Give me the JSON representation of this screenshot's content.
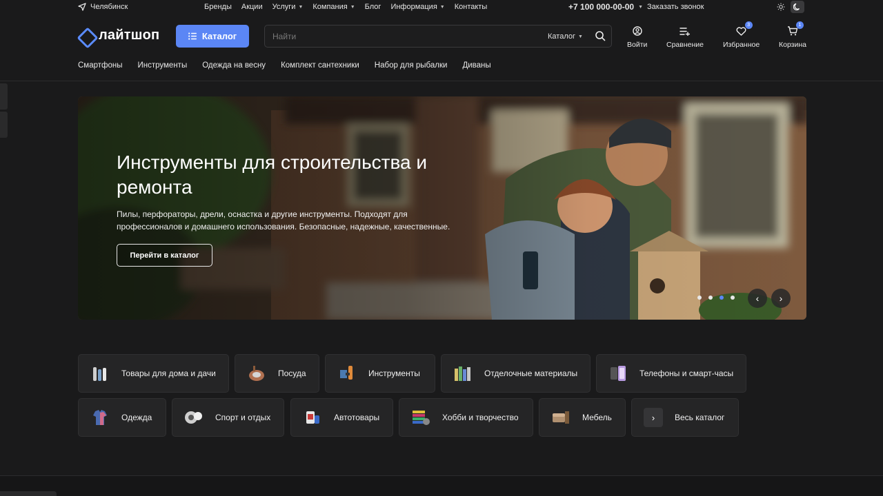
{
  "topbar": {
    "city": "Челябинск",
    "nav": [
      {
        "label": "Бренды",
        "caret": false
      },
      {
        "label": "Акции",
        "caret": false
      },
      {
        "label": "Услуги",
        "caret": true
      },
      {
        "label": "Компания",
        "caret": true
      },
      {
        "label": "Блог",
        "caret": false
      },
      {
        "label": "Информация",
        "caret": true
      },
      {
        "label": "Контакты",
        "caret": false
      }
    ],
    "phone": "+7 100 000-00-00",
    "callback": "Заказать звонок",
    "theme_light_icon": "sun-icon",
    "theme_dark_icon": "moon-icon"
  },
  "header": {
    "logo_text": "лайтшоп",
    "catalog_button": "Каталог",
    "search_placeholder": "Найти",
    "search_scope": "Каталог",
    "actions": [
      {
        "name": "login",
        "label": "Войти",
        "icon": "user-icon"
      },
      {
        "name": "compare",
        "label": "Сравнение",
        "icon": "compare-icon"
      },
      {
        "name": "favorites",
        "label": "Избранное",
        "icon": "heart-icon",
        "badge": "3"
      },
      {
        "name": "cart",
        "label": "Корзина",
        "icon": "cart-icon",
        "badge": "1"
      }
    ]
  },
  "subnav": [
    "Смартфоны",
    "Инструменты",
    "Одежда на весну",
    "Комплект сантехники",
    "Набор для рыбалки",
    "Диваны"
  ],
  "hero": {
    "title": "Инструменты для строительства и ремонта",
    "subtitle": "Пилы, перфораторы, дрели, оснастка и другие инструменты. Подходят для профессионалов и домашнего использования. Безопасные, надежные, качественные.",
    "button": "Перейти в каталог",
    "slides": 4,
    "active_slide": 3,
    "prev_icon": "chevron-left-icon",
    "next_icon": "chevron-right-icon"
  },
  "categories": {
    "row1": [
      {
        "label": "Товары для дома и дачи",
        "icon": "home-goods-icon"
      },
      {
        "label": "Посуда",
        "icon": "cookware-icon"
      },
      {
        "label": "Инструменты",
        "icon": "tools-icon"
      },
      {
        "label": "Отделочные материалы",
        "icon": "materials-icon"
      },
      {
        "label": "Телефоны и смарт-часы",
        "icon": "phone-icon"
      }
    ],
    "row2": [
      {
        "label": "Одежда",
        "icon": "clothes-icon"
      },
      {
        "label": "Спорт и отдых",
        "icon": "sport-icon"
      },
      {
        "label": "Автотовары",
        "icon": "auto-icon"
      },
      {
        "label": "Хобби и творчество",
        "icon": "hobby-icon"
      },
      {
        "label": "Мебель",
        "icon": "furniture-icon"
      },
      {
        "label": "Весь каталог",
        "icon": "chevron-right-icon"
      }
    ]
  },
  "colors": {
    "background": "#1a1a1b",
    "accent": "#5b86f5",
    "card": "#252526"
  }
}
